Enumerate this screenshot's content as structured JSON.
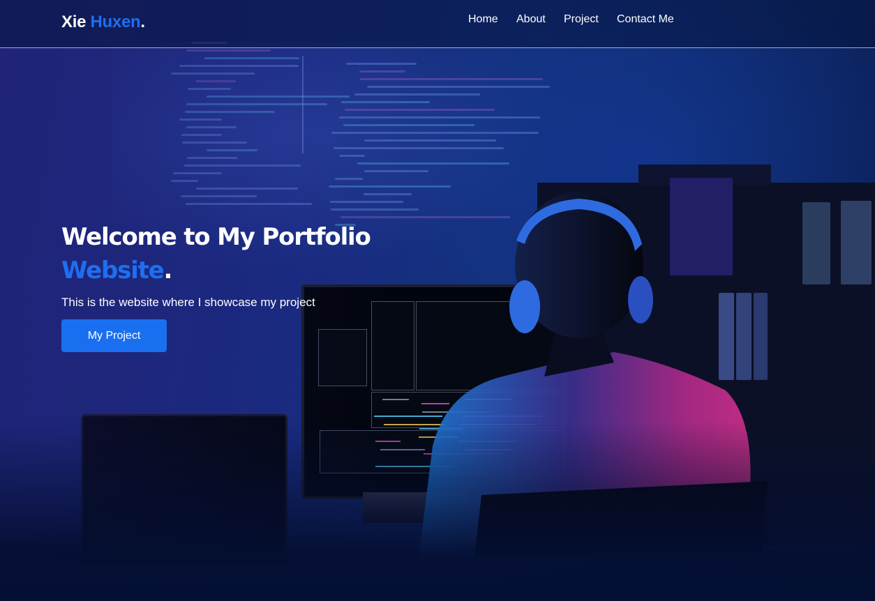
{
  "header": {
    "logo": {
      "first": "Xie",
      "second": "Huxen",
      "dot": "."
    },
    "nav": [
      {
        "label": "Home"
      },
      {
        "label": "About"
      },
      {
        "label": "Project"
      },
      {
        "label": "Contact Me"
      }
    ]
  },
  "hero": {
    "title_line1": "Welcome to My Portfolio",
    "title_accent": "Website",
    "title_dot": ".",
    "subtitle": "This is the website where I showcase my project",
    "button_label": "My Project"
  },
  "colors": {
    "accent": "#1e6ff0",
    "button": "#1a6ff0",
    "background": "#1b2a82"
  }
}
